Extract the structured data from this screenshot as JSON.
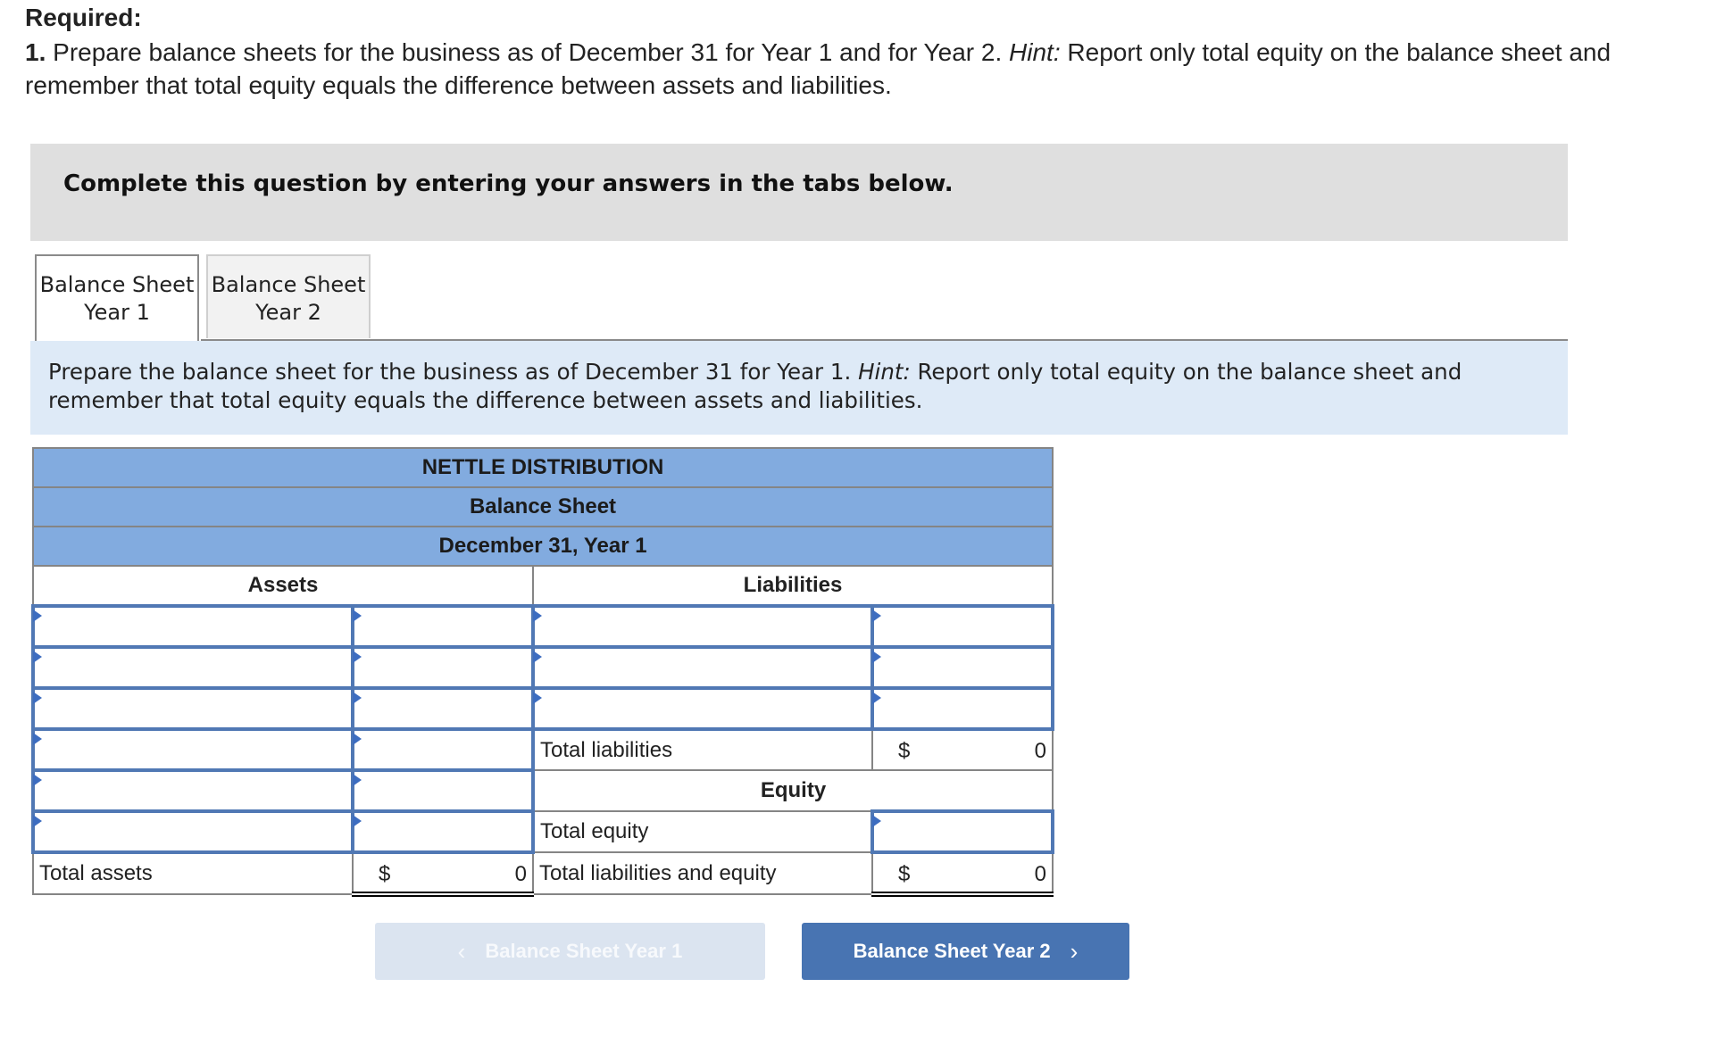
{
  "required": {
    "title": "Required:",
    "number": "1.",
    "text_main": " Prepare balance sheets for the business as of December 31 for Year 1 and for Year 2. ",
    "hint_label": "Hint:",
    "text_hint": " Report only total equity on the balance sheet and remember that total equity equals the difference between assets and liabilities."
  },
  "banner": "Complete this question by entering your answers in the tabs below.",
  "tabs": [
    {
      "line1": "Balance Sheet",
      "line2": "Year 1",
      "active": true
    },
    {
      "line1": "Balance Sheet",
      "line2": "Year 2",
      "active": false
    }
  ],
  "instructions": {
    "main": "Prepare the balance sheet for the business as of December 31 for Year 1. ",
    "hint_label": "Hint:",
    "hint": " Report only total equity on the balance sheet and remember that total equity equals the difference between assets and liabilities."
  },
  "sheet": {
    "company": "NETTLE DISTRIBUTION",
    "statement": "Balance Sheet",
    "date": "December 31, Year 1",
    "assets_header": "Assets",
    "liabilities_header": "Liabilities",
    "equity_header": "Equity",
    "total_liabilities_label": "Total liabilities",
    "total_liabilities_currency": "$",
    "total_liabilities_value": "0",
    "total_equity_label": "Total equity",
    "total_equity_value": "",
    "total_assets_label": "Total assets",
    "total_assets_currency": "$",
    "total_assets_value": "0",
    "total_le_label": "Total liabilities and equity",
    "total_le_currency": "$",
    "total_le_value": "0",
    "asset_rows": [
      {
        "name": "",
        "amount": ""
      },
      {
        "name": "",
        "amount": ""
      },
      {
        "name": "",
        "amount": ""
      },
      {
        "name": "",
        "amount": ""
      },
      {
        "name": "",
        "amount": ""
      },
      {
        "name": "",
        "amount": ""
      }
    ],
    "liability_rows": [
      {
        "name": "",
        "amount": ""
      },
      {
        "name": "",
        "amount": ""
      },
      {
        "name": "",
        "amount": ""
      }
    ]
  },
  "nav": {
    "prev_label": "Balance Sheet Year 1",
    "next_label": "Balance Sheet Year 2",
    "prev_icon": "chevron-left-icon",
    "next_icon": "chevron-right-icon",
    "prev_glyph": "‹",
    "next_glyph": "›"
  }
}
